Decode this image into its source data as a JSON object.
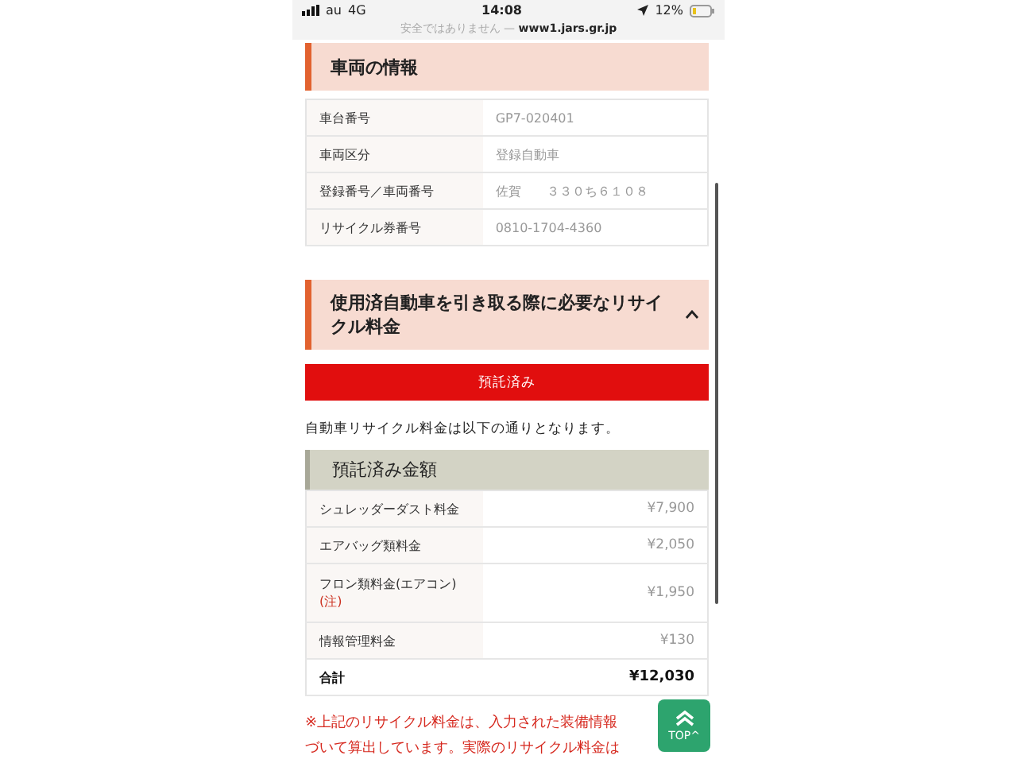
{
  "status_bar": {
    "carrier": "au",
    "network": "4G",
    "time": "14:08",
    "battery": "12%",
    "url_prefix": "安全ではありません —",
    "url": "www1.jars.gr.jp"
  },
  "vehicle_section": {
    "title": "車両の情報",
    "rows": [
      {
        "label": "車台番号",
        "value": "GP7-020401"
      },
      {
        "label": "車両区分",
        "value": "登録自動車"
      },
      {
        "label": "登録番号／車両番号",
        "value": "佐賀　　３３０ち６１０８"
      },
      {
        "label": "リサイクル券番号",
        "value": "0810-1704-4360"
      }
    ]
  },
  "fee_section": {
    "title": "使用済自動車を引き取る際に必要なリサイクル料金",
    "expanded": true,
    "status_button": "預託済み",
    "intro": "自動車リサイクル料金は以下の通りとなります。",
    "table_title": "預託済み金額",
    "rows": [
      {
        "label": "シュレッダーダスト料金",
        "value": "¥7,900",
        "kind": "item"
      },
      {
        "label": "エアバッグ類料金",
        "value": "¥2,050",
        "kind": "item"
      },
      {
        "label": "フロン類料金(エアコン)",
        "note": "(注)",
        "value": "¥1,950",
        "kind": "item"
      },
      {
        "label": "情報管理料金",
        "value": "¥130",
        "kind": "item"
      },
      {
        "label": "合計",
        "value": "¥12,030",
        "kind": "total"
      }
    ],
    "notes": [
      "※上記のリサイクル料金は、入力された装備情報",
      "づいて算出しています。実際のリサイクル料金は"
    ]
  },
  "top_button": "TOP^"
}
